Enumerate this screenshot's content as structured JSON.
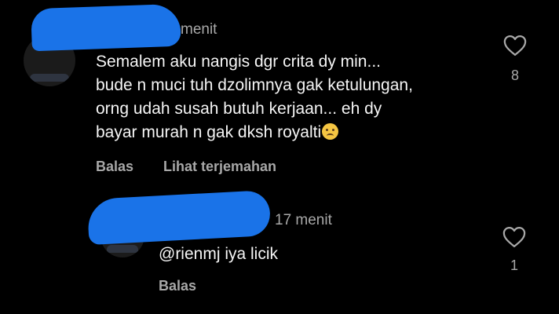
{
  "comments": [
    {
      "timestamp": "menit",
      "lines": [
        "Semalem aku nangis dgr crita dy min...",
        "bude n muci tuh dzolimnya gak ketulungan,",
        "orng udah susah butuh kerjaan... eh dy",
        "bayar murah n gak dksh royalti"
      ],
      "emoji": "crying-face-icon",
      "reply_label": "Balas",
      "translate_label": "Lihat terjemahan",
      "like_count": "8"
    },
    {
      "timestamp": "17 menit",
      "text": "@rienmj iya licik",
      "reply_label": "Balas",
      "like_count": "1"
    }
  ],
  "colors": {
    "background": "#000000",
    "primary_text": "#f5f5f5",
    "secondary_text": "#a8a8a8",
    "redaction": "#1a73e8"
  }
}
